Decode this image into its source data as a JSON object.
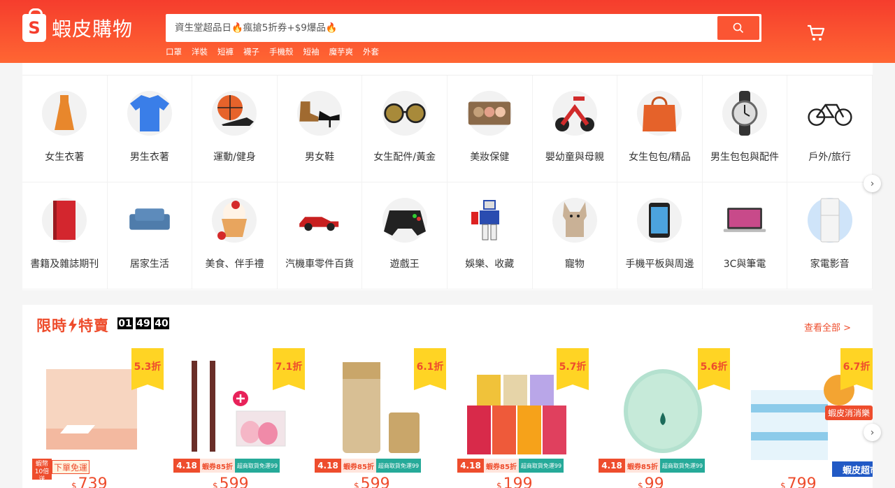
{
  "header": {
    "logo_text": "蝦皮購物",
    "search_placeholder": "資生堂超品日🔥瘋搶5折券+$9爆品🔥",
    "hot_words": [
      "口罩",
      "洋裝",
      "短褲",
      "襪子",
      "手機殼",
      "短袖",
      "魔芋爽",
      "外套"
    ]
  },
  "categories": [
    {
      "label": "女生衣著",
      "icon": "dress-icon"
    },
    {
      "label": "男生衣著",
      "icon": "tshirt-icon"
    },
    {
      "label": "運動/健身",
      "icon": "basketball-icon"
    },
    {
      "label": "男女鞋",
      "icon": "shoes-icon"
    },
    {
      "label": "女生配件/黃金",
      "icon": "sunglasses-icon"
    },
    {
      "label": "美妝保健",
      "icon": "eyeshadow-icon"
    },
    {
      "label": "嬰幼童與母親",
      "icon": "tricycle-icon"
    },
    {
      "label": "女生包包/精品",
      "icon": "handbag-icon"
    },
    {
      "label": "男生包包與配件",
      "icon": "watch-icon"
    },
    {
      "label": "戶外/旅行",
      "icon": "bicycle-icon"
    },
    {
      "label": "書籍及雜誌期刊",
      "icon": "book-icon"
    },
    {
      "label": "居家生活",
      "icon": "sofa-icon"
    },
    {
      "label": "美食、伴手禮",
      "icon": "cupcake-icon"
    },
    {
      "label": "汽機車零件百貨",
      "icon": "car-icon"
    },
    {
      "label": "遊戲王",
      "icon": "gamepad-icon"
    },
    {
      "label": "娛樂、收藏",
      "icon": "robot-figure-icon"
    },
    {
      "label": "寵物",
      "icon": "dog-icon"
    },
    {
      "label": "手機平板與周邊",
      "icon": "phone-icon"
    },
    {
      "label": "3C與筆電",
      "icon": "laptop-icon"
    },
    {
      "label": "家電影音",
      "icon": "fridge-icon"
    }
  ],
  "flash_sale": {
    "title_left": "限時",
    "title_right": "特賣",
    "timer": [
      "01",
      "49",
      "40"
    ],
    "view_all": "查看全部 >",
    "products": [
      {
        "discount": "5.3折",
        "price": "739",
        "tag1": "蝦幣10倍送",
        "tag2": "下單免運"
      },
      {
        "discount": "7.1折",
        "price": "599",
        "promo_date": "4.18",
        "promo_coupon": "蝦券85折",
        "promo_ship": "超商取貨免運99"
      },
      {
        "discount": "6.1折",
        "price": "599",
        "promo_date": "4.18",
        "promo_coupon": "蝦券85折",
        "promo_ship": "超商取貨免運99"
      },
      {
        "discount": "5.7折",
        "price": "199",
        "promo_date": "4.18",
        "promo_coupon": "蝦券85折",
        "promo_ship": "超商取貨免運99"
      },
      {
        "discount": "5.6折",
        "price": "99",
        "promo_date": "4.18",
        "promo_coupon": "蝦券85折",
        "promo_ship": "超商取貨免運99"
      },
      {
        "discount": "6.7折",
        "price": "799",
        "mascot_text": "蝦皮消消樂",
        "store_tag": "蝦皮超市"
      }
    ],
    "currency": "$"
  },
  "colors": {
    "brand": "#ee4d2d",
    "badge": "#ffd424"
  }
}
